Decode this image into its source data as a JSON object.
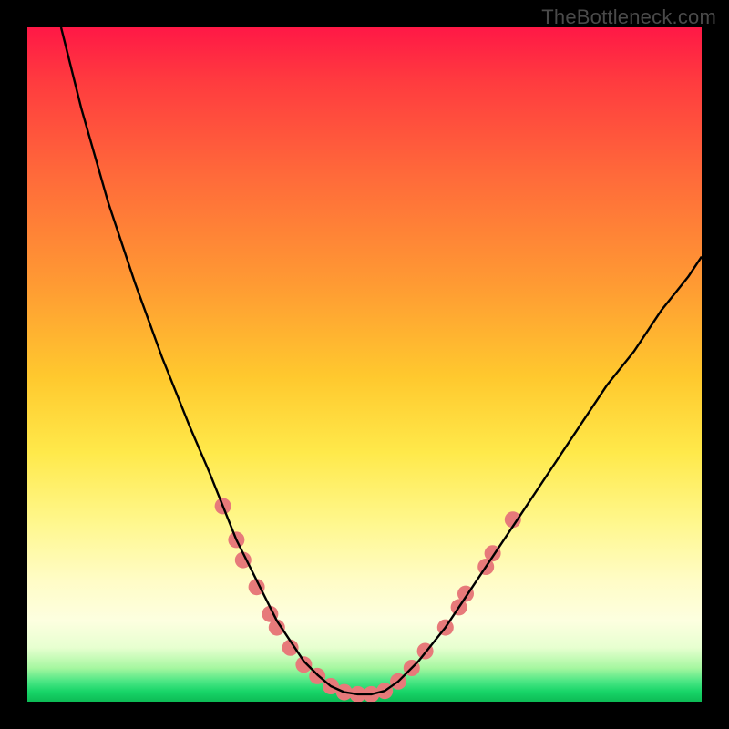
{
  "watermark": "TheBottleneck.com",
  "chart_data": {
    "type": "line",
    "title": "",
    "xlabel": "",
    "ylabel": "",
    "xlim": [
      0,
      100
    ],
    "ylim": [
      0,
      100
    ],
    "grid": false,
    "legend": false,
    "series": [
      {
        "name": "bottleneck-curve",
        "color": "#000000",
        "x": [
          5,
          8,
          12,
          16,
          20,
          24,
          27,
          29,
          31,
          33,
          35,
          37,
          39,
          41,
          43,
          45,
          47,
          49,
          51,
          53,
          55,
          58,
          62,
          66,
          70,
          74,
          78,
          82,
          86,
          90,
          94,
          98,
          100
        ],
        "y": [
          100,
          88,
          74,
          62,
          51,
          41,
          34,
          29,
          24,
          20,
          16,
          12,
          9,
          6,
          4,
          2.3,
          1.4,
          1.1,
          1.1,
          1.6,
          3,
          6,
          11,
          17,
          23,
          29,
          35,
          41,
          47,
          52,
          58,
          63,
          66
        ]
      }
    ],
    "markers": {
      "name": "highlight-points",
      "color": "#e77a7a",
      "radius_px": 9,
      "points": [
        {
          "x": 29,
          "y": 29
        },
        {
          "x": 31,
          "y": 24
        },
        {
          "x": 32,
          "y": 21
        },
        {
          "x": 34,
          "y": 17
        },
        {
          "x": 36,
          "y": 13
        },
        {
          "x": 37,
          "y": 11
        },
        {
          "x": 39,
          "y": 8
        },
        {
          "x": 41,
          "y": 5.5
        },
        {
          "x": 43,
          "y": 3.8
        },
        {
          "x": 45,
          "y": 2.3
        },
        {
          "x": 47,
          "y": 1.4
        },
        {
          "x": 49,
          "y": 1.1
        },
        {
          "x": 51,
          "y": 1.1
        },
        {
          "x": 53,
          "y": 1.6
        },
        {
          "x": 55,
          "y": 3
        },
        {
          "x": 57,
          "y": 5
        },
        {
          "x": 59,
          "y": 7.5
        },
        {
          "x": 62,
          "y": 11
        },
        {
          "x": 64,
          "y": 14
        },
        {
          "x": 65,
          "y": 16
        },
        {
          "x": 68,
          "y": 20
        },
        {
          "x": 69,
          "y": 22
        },
        {
          "x": 72,
          "y": 27
        }
      ]
    },
    "background_gradient": {
      "stops": [
        {
          "pos": 0.0,
          "color": "#ff1846"
        },
        {
          "pos": 0.08,
          "color": "#ff3b3f"
        },
        {
          "pos": 0.22,
          "color": "#ff6a3a"
        },
        {
          "pos": 0.38,
          "color": "#ff9a33"
        },
        {
          "pos": 0.52,
          "color": "#ffc92e"
        },
        {
          "pos": 0.63,
          "color": "#ffe94a"
        },
        {
          "pos": 0.73,
          "color": "#fff78a"
        },
        {
          "pos": 0.82,
          "color": "#fffcc6"
        },
        {
          "pos": 0.88,
          "color": "#fdffe0"
        },
        {
          "pos": 0.92,
          "color": "#e7ffd0"
        },
        {
          "pos": 0.95,
          "color": "#a6f7a0"
        },
        {
          "pos": 0.97,
          "color": "#4be684"
        },
        {
          "pos": 0.985,
          "color": "#18d568"
        },
        {
          "pos": 1.0,
          "color": "#0dbb55"
        }
      ]
    }
  }
}
